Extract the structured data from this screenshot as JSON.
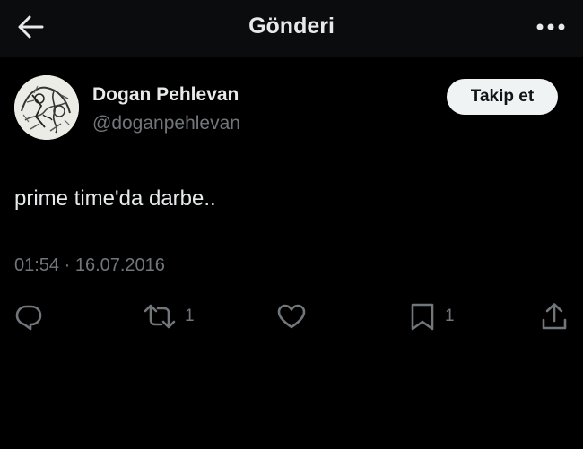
{
  "header": {
    "title": "Gönderi",
    "back_icon": "arrow-left-icon",
    "more_icon": "more-horizontal-icon"
  },
  "author": {
    "display_name": "Dogan Pehlevan",
    "handle": "@doganpehlevan",
    "follow_label": "Takip et"
  },
  "tweet": {
    "text": "prime time'da darbe..",
    "timestamp": "01:54 · 16.07.2016"
  },
  "actions": {
    "reply_icon": "reply-icon",
    "retweet_icon": "retweet-icon",
    "retweet_count": "1",
    "like_icon": "heart-icon",
    "bookmark_icon": "bookmark-icon",
    "bookmark_count": "1",
    "share_icon": "share-icon"
  },
  "colors": {
    "background": "#000000",
    "header_background": "#0b0c0d",
    "primary_text": "#e7e9ea",
    "secondary_text": "#71767b",
    "follow_button_bg": "#eff3f4"
  }
}
